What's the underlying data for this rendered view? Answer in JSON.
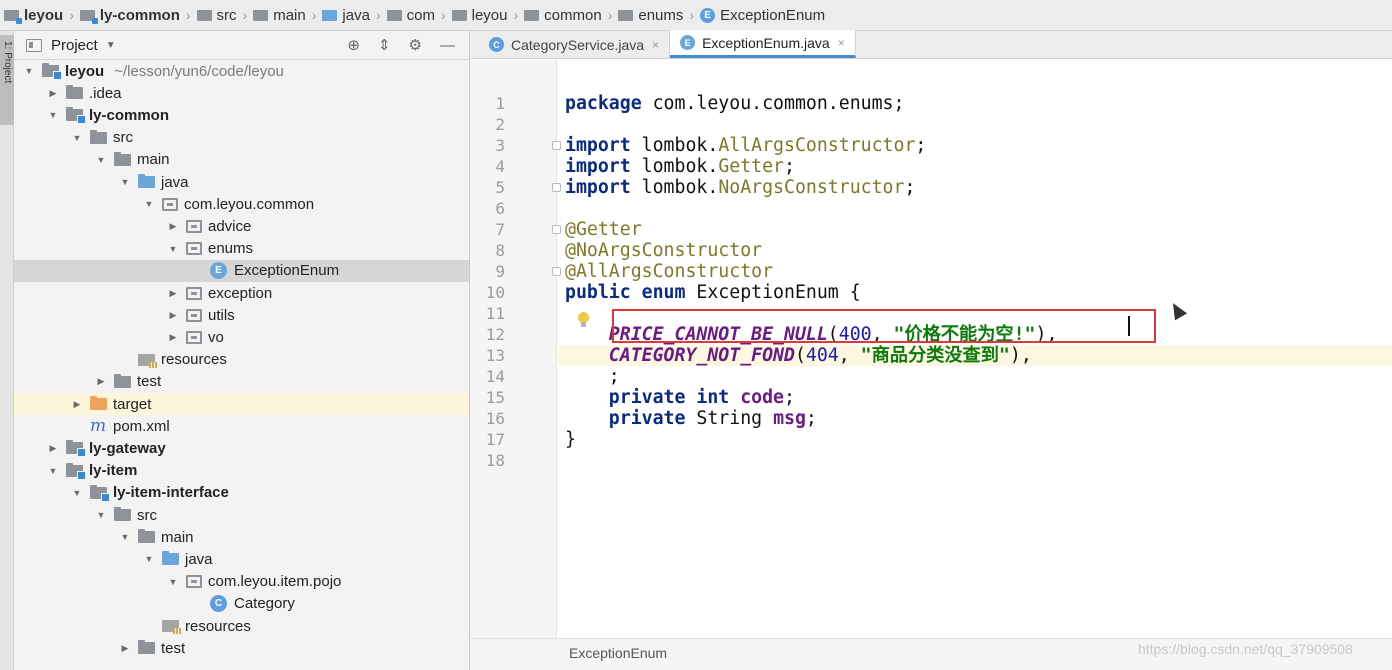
{
  "breadcrumb": [
    {
      "label": "leyou",
      "icon": "module-icon",
      "bold": true
    },
    {
      "label": "ly-common",
      "icon": "module-icon",
      "bold": true
    },
    {
      "label": "src",
      "icon": "folder-icon"
    },
    {
      "label": "main",
      "icon": "folder-icon"
    },
    {
      "label": "java",
      "icon": "source-folder-icon"
    },
    {
      "label": "com",
      "icon": "package-icon"
    },
    {
      "label": "leyou",
      "icon": "package-icon"
    },
    {
      "label": "common",
      "icon": "package-icon"
    },
    {
      "label": "enums",
      "icon": "package-icon"
    },
    {
      "label": "ExceptionEnum",
      "icon": "enum-class-icon"
    }
  ],
  "toolstrip": {
    "tab_label": "1: Project"
  },
  "project": {
    "title": "Project",
    "tree": [
      {
        "label": "leyou",
        "path": "~/lesson/yun6/code/leyou",
        "depth": 0,
        "expanded": true,
        "icon": "module",
        "bold": true
      },
      {
        "label": ".idea",
        "depth": 1,
        "expanded": false,
        "icon": "folder"
      },
      {
        "label": "ly-common",
        "depth": 1,
        "expanded": true,
        "icon": "module",
        "bold": true
      },
      {
        "label": "src",
        "depth": 2,
        "expanded": true,
        "icon": "folder"
      },
      {
        "label": "main",
        "depth": 3,
        "expanded": true,
        "icon": "folder"
      },
      {
        "label": "java",
        "depth": 4,
        "expanded": true,
        "icon": "blue"
      },
      {
        "label": "com.leyou.common",
        "depth": 5,
        "expanded": true,
        "icon": "pkg"
      },
      {
        "label": "advice",
        "depth": 6,
        "expanded": false,
        "icon": "pkg"
      },
      {
        "label": "enums",
        "depth": 6,
        "expanded": true,
        "icon": "pkg"
      },
      {
        "label": "ExceptionEnum",
        "depth": 7,
        "icon": "enum",
        "selected": true
      },
      {
        "label": "exception",
        "depth": 6,
        "expanded": false,
        "icon": "pkg"
      },
      {
        "label": "utils",
        "depth": 6,
        "expanded": false,
        "icon": "pkg"
      },
      {
        "label": "vo",
        "depth": 6,
        "expanded": false,
        "icon": "pkg"
      },
      {
        "label": "resources",
        "depth": 4,
        "icon": "res"
      },
      {
        "label": "test",
        "depth": 3,
        "expanded": false,
        "icon": "folder"
      },
      {
        "label": "target",
        "depth": 2,
        "expanded": false,
        "icon": "orange",
        "highlight": true
      },
      {
        "label": "pom.xml",
        "depth": 2,
        "icon": "maven"
      },
      {
        "label": "ly-gateway",
        "depth": 1,
        "expanded": false,
        "icon": "module",
        "bold": true
      },
      {
        "label": "ly-item",
        "depth": 1,
        "expanded": true,
        "icon": "module",
        "bold": true
      },
      {
        "label": "ly-item-interface",
        "depth": 2,
        "expanded": true,
        "icon": "module",
        "bold": true
      },
      {
        "label": "src",
        "depth": 3,
        "expanded": true,
        "icon": "folder"
      },
      {
        "label": "main",
        "depth": 4,
        "expanded": true,
        "icon": "folder"
      },
      {
        "label": "java",
        "depth": 5,
        "expanded": true,
        "icon": "blue"
      },
      {
        "label": "com.leyou.item.pojo",
        "depth": 6,
        "expanded": true,
        "icon": "pkg"
      },
      {
        "label": "Category",
        "depth": 7,
        "icon": "class"
      },
      {
        "label": "resources",
        "depth": 5,
        "icon": "res"
      },
      {
        "label": "test",
        "depth": 4,
        "expanded": false,
        "icon": "folder"
      }
    ]
  },
  "editor": {
    "tabs": [
      {
        "label": "CategoryService.java",
        "icon": "class-icon",
        "active": false
      },
      {
        "label": "ExceptionEnum.java",
        "icon": "enum-class-icon",
        "active": true
      }
    ],
    "line_numbers": [
      "1",
      "2",
      "3",
      "4",
      "5",
      "6",
      "7",
      "8",
      "9",
      "10",
      "11",
      "12",
      "13",
      "14",
      "15",
      "16",
      "17",
      "18"
    ],
    "lines": [
      [
        {
          "t": "package ",
          "c": "kw"
        },
        {
          "t": "com.leyou.common.enums;",
          "c": "plain"
        }
      ],
      [],
      [
        {
          "t": "import ",
          "c": "kw"
        },
        {
          "t": "lombok.",
          "c": "plain"
        },
        {
          "t": "AllArgsConstructor",
          "c": "ty"
        },
        {
          "t": ";",
          "c": "plain"
        }
      ],
      [
        {
          "t": "import ",
          "c": "kw"
        },
        {
          "t": "lombok.",
          "c": "plain"
        },
        {
          "t": "Getter",
          "c": "ty"
        },
        {
          "t": ";",
          "c": "plain"
        }
      ],
      [
        {
          "t": "import ",
          "c": "kw"
        },
        {
          "t": "lombok.",
          "c": "plain"
        },
        {
          "t": "NoArgsConstructor",
          "c": "ty"
        },
        {
          "t": ";",
          "c": "plain"
        }
      ],
      [],
      [
        {
          "t": "@Getter",
          "c": "ann"
        }
      ],
      [
        {
          "t": "@NoArgsConstructor",
          "c": "ann"
        }
      ],
      [
        {
          "t": "@AllArgsConstructor",
          "c": "ann"
        }
      ],
      [
        {
          "t": "public enum ",
          "c": "kw"
        },
        {
          "t": "ExceptionEnum {",
          "c": "plain"
        }
      ],
      [],
      [
        {
          "t": "    PRICE_CANNOT_BE_NULL",
          "c": "const"
        },
        {
          "t": "(",
          "c": "plain"
        },
        {
          "t": "400",
          "c": "num"
        },
        {
          "t": ", ",
          "c": "plain"
        },
        {
          "t": "\"价格不能为空!\"",
          "c": "str"
        },
        {
          "t": "),",
          "c": "plain"
        }
      ],
      [
        {
          "t": "    CATEGORY_NOT_FOND",
          "c": "const"
        },
        {
          "t": "(",
          "c": "plain"
        },
        {
          "t": "404",
          "c": "num"
        },
        {
          "t": ", ",
          "c": "plain"
        },
        {
          "t": "\"商品分类没查到\"",
          "c": "str"
        },
        {
          "t": "),",
          "c": "plain"
        }
      ],
      [
        {
          "t": "    ;",
          "c": "plain"
        }
      ],
      [
        {
          "t": "    private int ",
          "c": "kw"
        },
        {
          "t": "code",
          "c": "fld"
        },
        {
          "t": ";",
          "c": "plain"
        }
      ],
      [
        {
          "t": "    private ",
          "c": "kw"
        },
        {
          "t": "String ",
          "c": "plain"
        },
        {
          "t": "msg",
          "c": "fld"
        },
        {
          "t": ";",
          "c": "plain"
        }
      ],
      [
        {
          "t": "}",
          "c": "plain"
        }
      ],
      []
    ],
    "current_line": 13,
    "footer_label": "ExceptionEnum"
  },
  "watermark": "https://blog.csdn.net/qq_37909508"
}
